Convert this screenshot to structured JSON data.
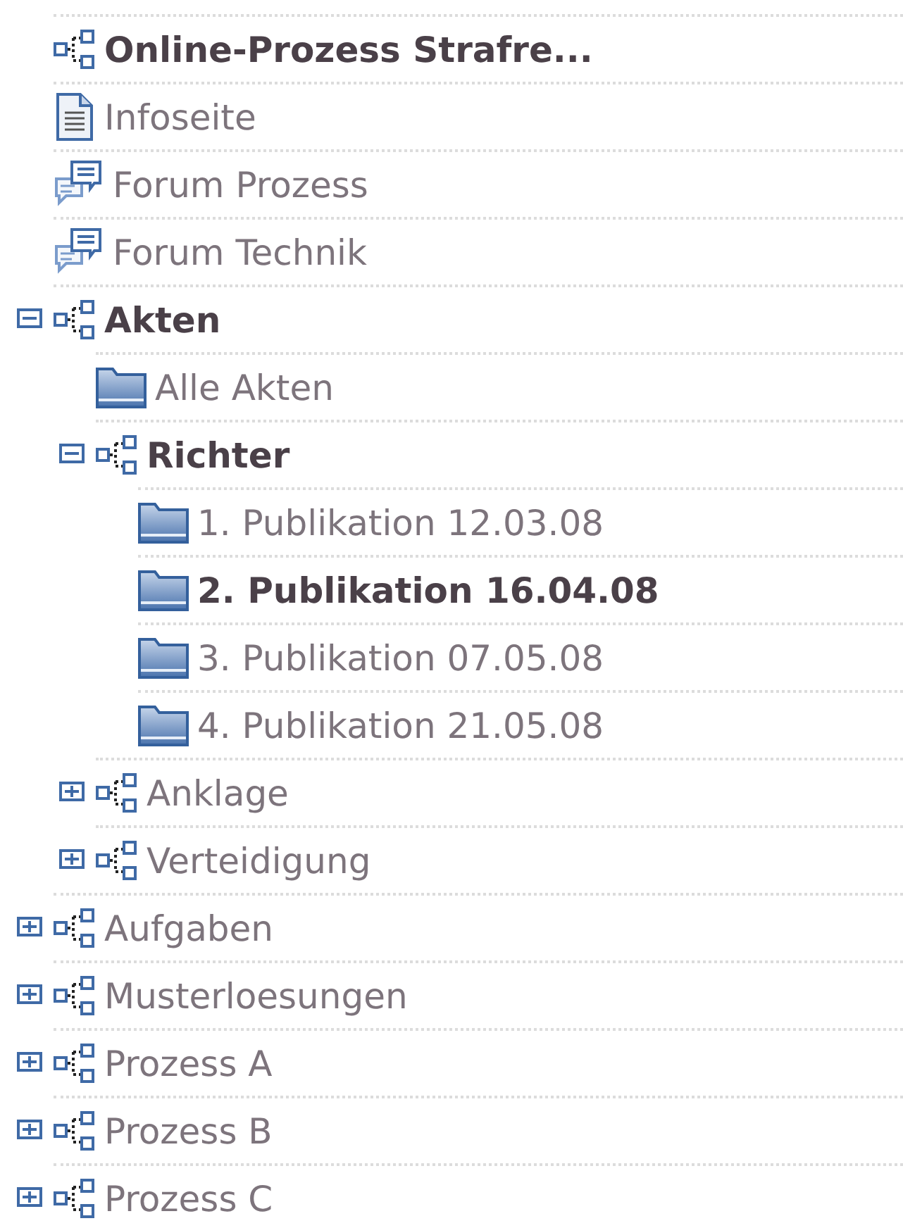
{
  "tree": [
    {
      "label": "Online-Prozess Strafre...",
      "kind": "group",
      "selected": true
    },
    {
      "label": "Infoseite",
      "kind": "page",
      "selected": false
    },
    {
      "label": "Forum Prozess",
      "kind": "forum",
      "selected": false
    },
    {
      "label": "Forum Technik",
      "kind": "forum",
      "selected": false
    },
    {
      "label": "Akten",
      "kind": "group",
      "selected": true,
      "expanded": true,
      "children": [
        {
          "label": "Alle Akten",
          "kind": "folder",
          "selected": false
        },
        {
          "label": "Richter",
          "kind": "group",
          "selected": true,
          "expanded": true,
          "children": [
            {
              "label": "1. Publikation 12.03.08",
              "kind": "folder",
              "selected": false
            },
            {
              "label": "2. Publikation 16.04.08",
              "kind": "folder",
              "selected": true
            },
            {
              "label": "3. Publikation 07.05.08",
              "kind": "folder",
              "selected": false
            },
            {
              "label": "4. Publikation 21.05.08",
              "kind": "folder",
              "selected": false
            }
          ]
        },
        {
          "label": "Anklage",
          "kind": "group",
          "selected": false,
          "expanded": false
        },
        {
          "label": "Verteidigung",
          "kind": "group",
          "selected": false,
          "expanded": false
        }
      ]
    },
    {
      "label": "Aufgaben",
      "kind": "group",
      "selected": false,
      "expanded": false
    },
    {
      "label": "Musterloesungen",
      "kind": "group",
      "selected": false,
      "expanded": false
    },
    {
      "label": "Prozess A",
      "kind": "group",
      "selected": false,
      "expanded": false
    },
    {
      "label": "Prozess B",
      "kind": "group",
      "selected": false,
      "expanded": false
    },
    {
      "label": "Prozess C",
      "kind": "group",
      "selected": false,
      "expanded": false
    }
  ]
}
